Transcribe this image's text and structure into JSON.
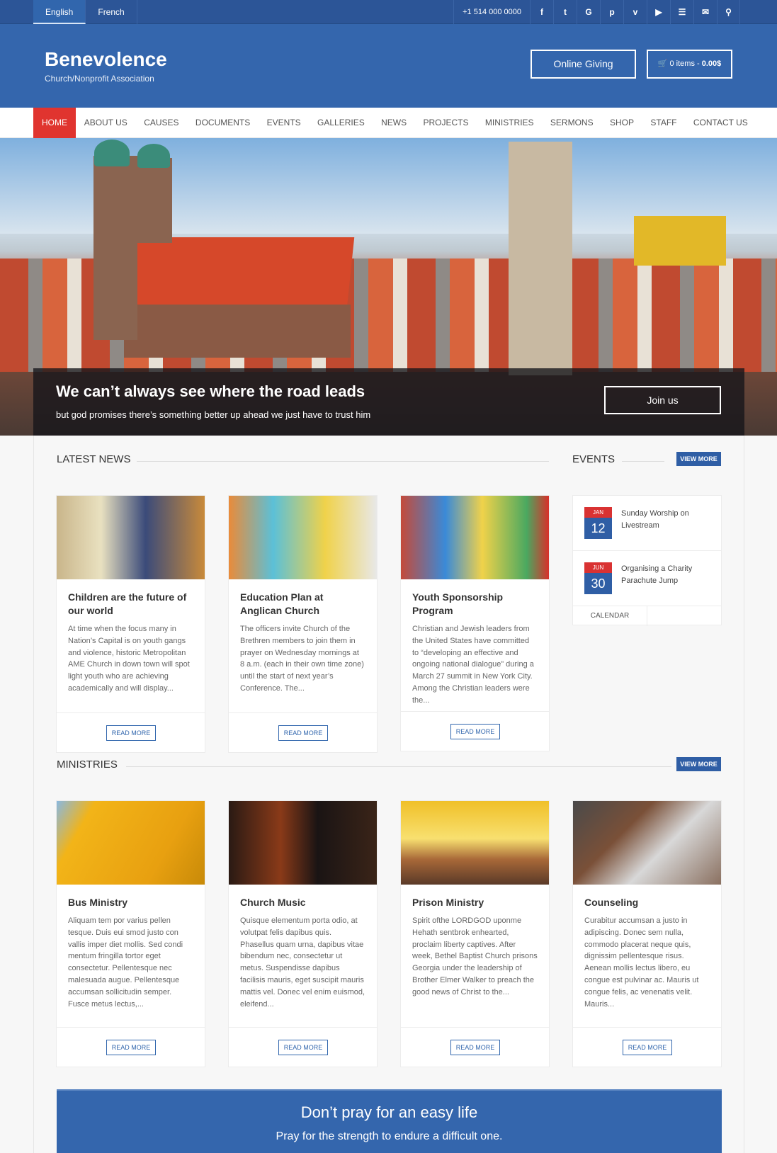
{
  "topbar": {
    "languages": [
      {
        "label": "English",
        "active": true
      },
      {
        "label": "French",
        "active": false
      }
    ],
    "phone": "+1 514 000 0000",
    "icons": [
      {
        "name": "facebook-icon",
        "glyph": "f"
      },
      {
        "name": "twitter-icon",
        "glyph": "t"
      },
      {
        "name": "google-plus-icon",
        "glyph": "G"
      },
      {
        "name": "pinterest-icon",
        "glyph": "p"
      },
      {
        "name": "vimeo-icon",
        "glyph": "v"
      },
      {
        "name": "youtube-icon",
        "glyph": "▶"
      },
      {
        "name": "rss-icon",
        "glyph": "☰"
      },
      {
        "name": "mail-icon",
        "glyph": "✉"
      },
      {
        "name": "search-icon",
        "glyph": "⚲"
      }
    ]
  },
  "header": {
    "site_title": "Benevolence",
    "tagline": "Church/Nonprofit Association",
    "giving_label": "Online Giving",
    "cart_icon": "🛒",
    "cart_items": "0 items - ",
    "cart_total": "0.00$"
  },
  "nav": {
    "items": [
      "HOME",
      "ABOUT US",
      "CAUSES",
      "DOCUMENTS",
      "EVENTS",
      "GALLERIES",
      "NEWS",
      "PROJECTS",
      "MINISTRIES",
      "SERMONS",
      "SHOP",
      "STAFF",
      "CONTACT US"
    ],
    "active": "HOME"
  },
  "hero": {
    "title": "We can’t always see where the road leads",
    "subtitle": "but god promises there’s something better up ahead we just have to trust him",
    "button": "Join us"
  },
  "news": {
    "title": "LATEST NEWS",
    "items": [
      {
        "title": "Children are the future of our world",
        "excerpt": "At time when the focus many in Nation’s Capital is on youth gangs and violence, historic Metropolitan AME Church in down town will spot light youth who are achieving academically and will display...",
        "button": "READ MORE"
      },
      {
        "title": "Education Plan at Anglican Church",
        "excerpt": "The officers invite Church of the Brethren members to join them in prayer on Wednesday mornings at 8 a.m. (each in their own time zone) until the start of next year’s Conference. The...",
        "button": "READ MORE"
      },
      {
        "title": "Youth Sponsorship Program",
        "excerpt": "Christian and Jewish leaders from the United States have committed to “developing an effective and ongoing national dialogue” during a March 27 summit in New York City. Among the Christian leaders were the...",
        "button": "READ MORE"
      }
    ]
  },
  "events": {
    "title": "EVENTS",
    "view_more": "VIEW MORE",
    "items": [
      {
        "month": "JAN",
        "day": "12",
        "title": "Sunday Worship on Livestream"
      },
      {
        "month": "JUN",
        "day": "30",
        "title": "Organising a Charity Parachute Jump"
      }
    ],
    "calendar_label": "CALENDAR"
  },
  "ministries": {
    "title": "MINISTRIES",
    "view_more": "VIEW MORE",
    "items": [
      {
        "title": "Bus Ministry",
        "excerpt": "Aliquam tem por varius pellen tesque. Duis eui smod justo con vallis imper diet mollis. Sed condi mentum fringilla tortor eget consectetur. Pellentesque nec malesuada augue. Pellentesque accumsan sollicitudin semper. Fusce metus lectus,...",
        "button": "READ MORE"
      },
      {
        "title": "Church Music",
        "excerpt": "Quisque elementum porta odio, at volutpat felis dapibus quis. Phasellus quam urna, dapibus vitae bibendum nec, consectetur ut metus. Suspendisse dapibus facilisis mauris, eget suscipit mauris mattis vel. Donec vel enim euismod, eleifend...",
        "button": "READ MORE"
      },
      {
        "title": "Prison Ministry",
        "excerpt": "Spirit ofthe LORDGOD uponme Hehath sentbrok enhearted, proclaim liberty  captives. After week, Bethel Baptist Church prisons Georgia under the leadership of Brother Elmer Walker to preach the good news of Christ to the...",
        "button": "READ MORE"
      },
      {
        "title": "Counseling",
        "excerpt": "Curabitur accumsan a justo in adipiscing. Donec sem nulla, commodo placerat neque quis, dignissim pellentesque risus. Aenean mollis lectus libero, eu congue est pulvinar ac. Mauris ut congue felis, ac venenatis velit. Mauris...",
        "button": "READ MORE"
      }
    ]
  },
  "quote": {
    "title": "Don’t pray for an easy life",
    "subtitle": "Pray for the strength to endure a difficult one."
  },
  "colors": {
    "primary": "#3466ad",
    "topbar": "#2c5597",
    "accent_red": "#e0342f",
    "button_blue": "#2f5ea5"
  }
}
